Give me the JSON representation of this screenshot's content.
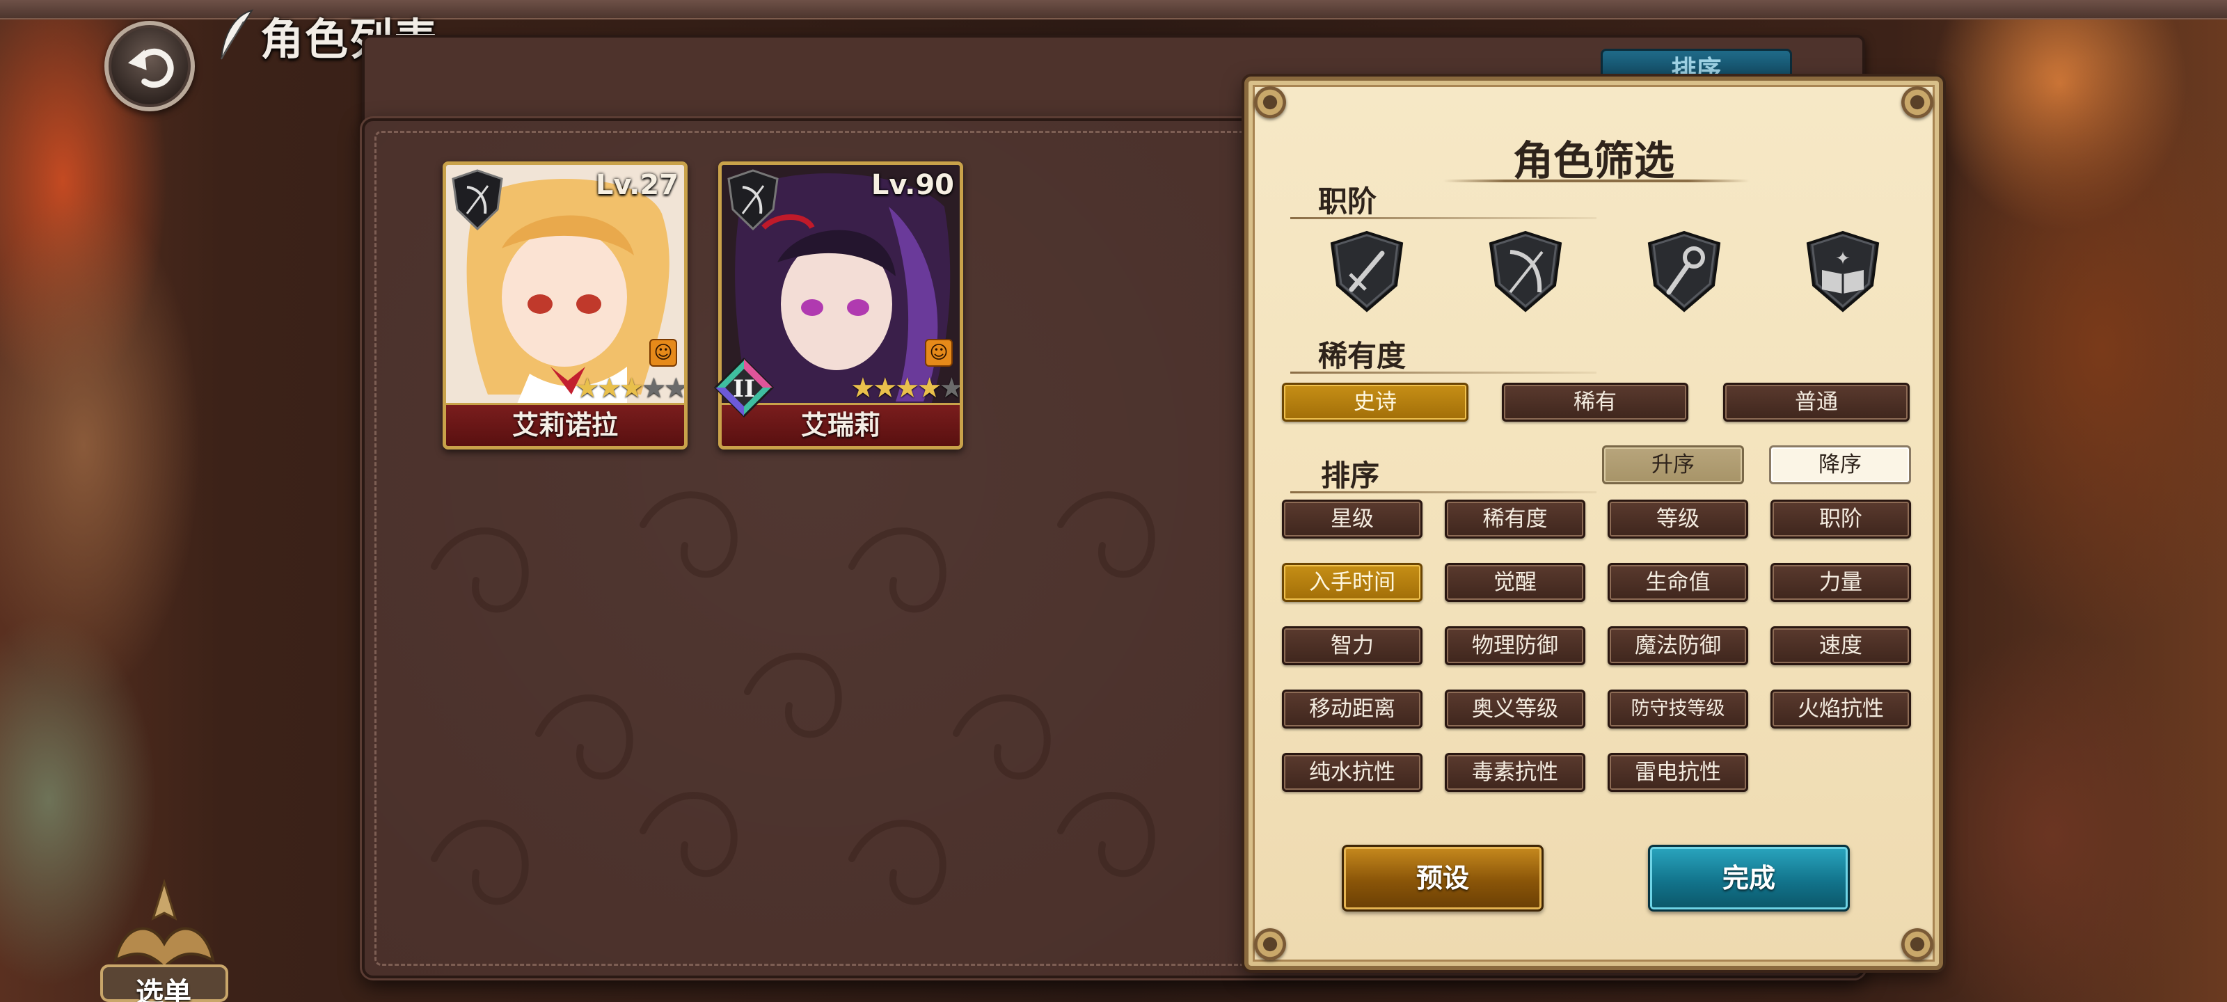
{
  "header": {
    "title": "角色列表",
    "back_icon": "back-arrow-icon",
    "sort_tab_label": "排序"
  },
  "characters": [
    {
      "name": "艾莉诺拉",
      "level": "Lv.27",
      "stars": 3,
      "max_stars": 5,
      "class_icon": "bow-shield-icon",
      "hair_color": "#f2c06a"
    },
    {
      "name": "艾瑞莉",
      "level": "Lv.90",
      "stars": 4,
      "max_stars": 5,
      "class_icon": "bow-shield-icon",
      "hair_color": "#3a1f4a",
      "awaken_rank": "II"
    }
  ],
  "filter_panel": {
    "title": "角色筛选",
    "class_section": {
      "label": "职阶",
      "icons": [
        "sword-shield-icon",
        "bow-shield-icon",
        "staff-shield-icon",
        "book-shield-icon"
      ]
    },
    "rarity_section": {
      "label": "稀有度",
      "options": [
        "史诗",
        "稀有",
        "普通"
      ],
      "selected": "史诗"
    },
    "sort_section": {
      "label": "排序",
      "order_asc": "升序",
      "order_desc": "降序",
      "order_selected": "降序",
      "options": [
        "星级",
        "稀有度",
        "等级",
        "职阶",
        "入手时间",
        "觉醒",
        "生命值",
        "力量",
        "智力",
        "物理防御",
        "魔法防御",
        "速度",
        "移动距离",
        "奥义等级",
        "防守技等级",
        "火焰抗性",
        "纯水抗性",
        "毒素抗性",
        "雷电抗性"
      ],
      "selected": "入手时间"
    },
    "preset_label": "预设",
    "done_label": "完成"
  },
  "menu": {
    "label": "选单"
  },
  "colors": {
    "active_gold": "#b07a0c",
    "dark_button": "#4a2e24",
    "done_teal": "#12748c"
  }
}
